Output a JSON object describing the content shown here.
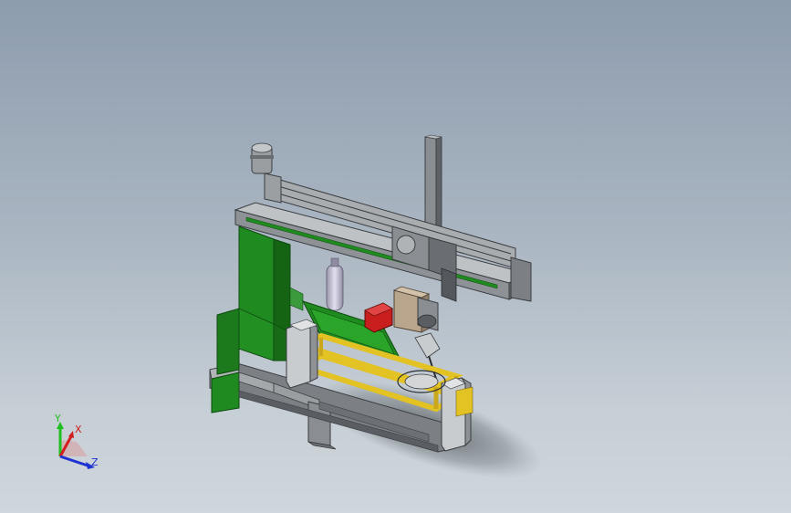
{
  "viewport": {
    "background_top": "#8d9cae",
    "background_bottom": "#cfd6dc"
  },
  "model": {
    "colors": {
      "frame_green": "#1f8a1f",
      "frame_green_dark": "#146414",
      "steel_gray": "#8e9296",
      "steel_light": "#c9ccce",
      "steel_dark": "#54585c",
      "fixture_yellow": "#e3c224",
      "gas_cylinder": "#c9c6d6",
      "wire_feeder_red": "#c81e1e",
      "cabinet_tan": "#b8a58c"
    }
  },
  "triad": {
    "y_label": "Y",
    "x_label": "X",
    "z_label": "Z",
    "y_color": "#1fbf1f",
    "x_color": "#d21e1e",
    "z_color": "#1e32d2"
  }
}
